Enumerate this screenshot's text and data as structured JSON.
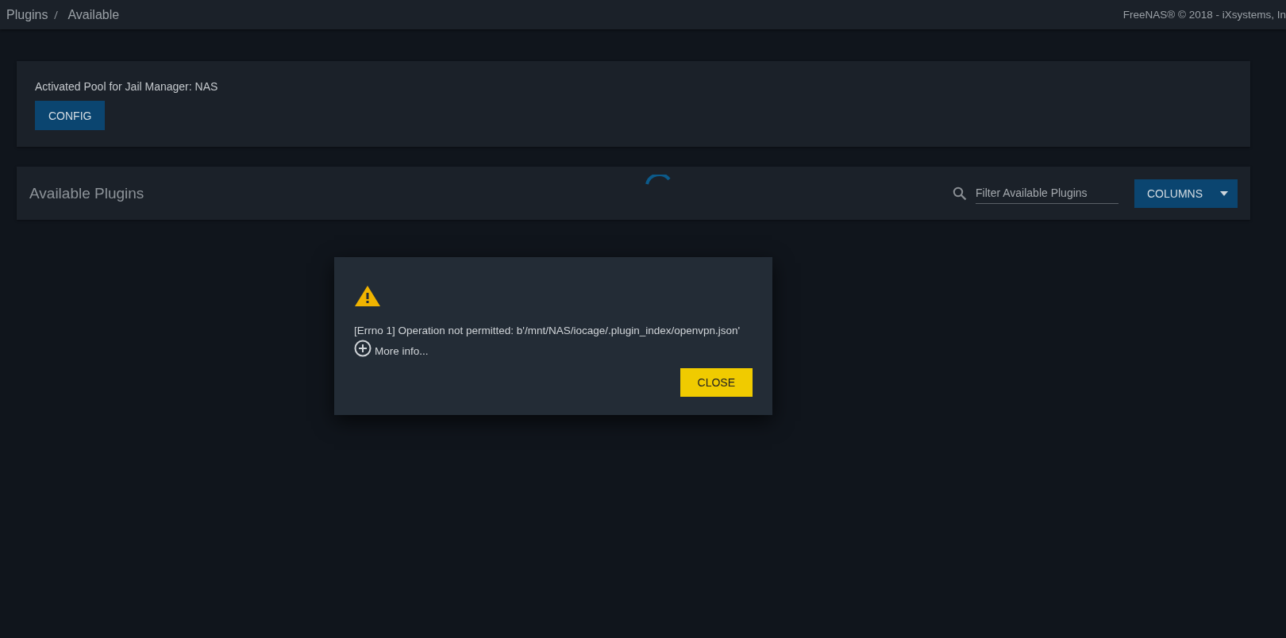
{
  "breadcrumb": [
    "Plugins",
    "Available"
  ],
  "copyright": "FreeNAS® © 2018 - iXsystems, In",
  "pool_card": {
    "label": "Activated Pool for Jail Manager: NAS",
    "button": "CONFIG"
  },
  "plugins_card": {
    "title": "Available Plugins",
    "loading": true,
    "search": {
      "placeholder": "Filter Available Plugins"
    },
    "columns_button": "COLUMNS"
  },
  "dialog": {
    "message": "[Errno 1] Operation not permitted: b'/mnt/NAS/iocage/.plugin_index/openvpn.json'",
    "more_info": "More info...",
    "button": "CLOSE"
  }
}
